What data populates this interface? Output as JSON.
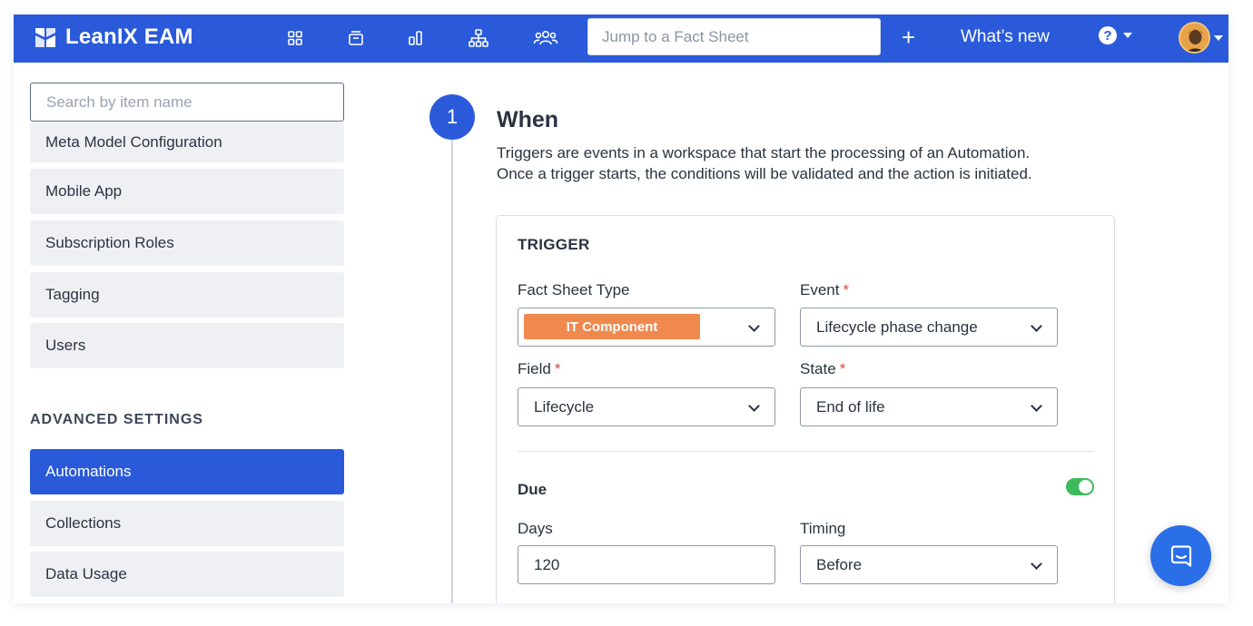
{
  "header": {
    "app_name": "LeanIX EAM",
    "nav_icons": [
      "grid-icon",
      "inbox-icon",
      "bar-chart-icon",
      "hierarchy-icon",
      "people-icon"
    ],
    "search_placeholder": "Jump to a Fact Sheet",
    "add_label": "+",
    "whats_new": "What’s new",
    "help_label": "?"
  },
  "sidebar": {
    "search_placeholder": "Search by item name",
    "items": [
      {
        "label": "Meta Model Configuration"
      },
      {
        "label": "Mobile App"
      },
      {
        "label": "Subscription Roles"
      },
      {
        "label": "Tagging"
      },
      {
        "label": "Users"
      }
    ],
    "advanced_header": "ADVANCED SETTINGS",
    "advanced_items": [
      {
        "label": "Automations",
        "active": true
      },
      {
        "label": "Collections"
      },
      {
        "label": "Data Usage"
      }
    ]
  },
  "main": {
    "step_number": "1",
    "title": "When",
    "description_line1": "Triggers are events in a workspace that start the processing of an Automation.",
    "description_line2": "Once a trigger starts, the conditions will be validated and the action is initiated.",
    "trigger": {
      "title": "TRIGGER",
      "fact_sheet_type_label": "Fact Sheet Type",
      "fact_sheet_type_value": "IT Component",
      "fact_sheet_type_color": "#f0894e",
      "event_label": "Event",
      "event_value": "Lifecycle phase change",
      "field_label": "Field",
      "field_value": "Lifecycle",
      "state_label": "State",
      "state_value": "End of life",
      "required_mark": "*",
      "due_label": "Due",
      "due_enabled": true,
      "days_label": "Days",
      "days_value": "120",
      "timing_label": "Timing",
      "timing_value": "Before"
    }
  },
  "colors": {
    "brand": "#2a5ad9",
    "toggle_on": "#3dba5a",
    "required": "#e0483e"
  }
}
